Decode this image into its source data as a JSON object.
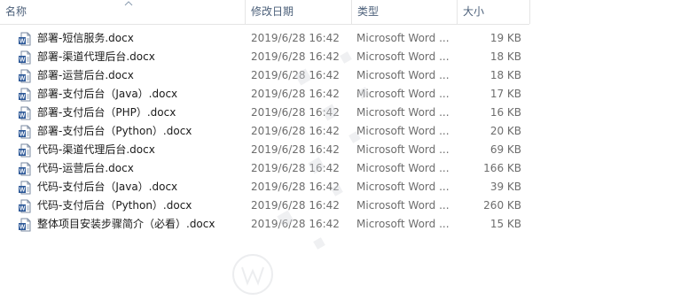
{
  "columns": {
    "name": "名称",
    "date": "修改日期",
    "type": "类型",
    "size": "大小"
  },
  "files": [
    {
      "name": "部署-短信服务.docx",
      "date": "2019/6/28 16:42",
      "type": "Microsoft Word ...",
      "size": "19 KB",
      "icon": "word-doc-icon"
    },
    {
      "name": "部署-渠道代理后台.docx",
      "date": "2019/6/28 16:42",
      "type": "Microsoft Word ...",
      "size": "18 KB",
      "icon": "word-doc-icon"
    },
    {
      "name": "部署-运营后台.docx",
      "date": "2019/6/28 16:42",
      "type": "Microsoft Word ...",
      "size": "18 KB",
      "icon": "word-doc-icon"
    },
    {
      "name": "部署-支付后台（Java）.docx",
      "date": "2019/6/28 16:42",
      "type": "Microsoft Word ...",
      "size": "17 KB",
      "icon": "word-doc-icon"
    },
    {
      "name": "部署-支付后台（PHP）.docx",
      "date": "2019/6/28 16:42",
      "type": "Microsoft Word ...",
      "size": "16 KB",
      "icon": "word-doc-icon"
    },
    {
      "name": "部署-支付后台（Python）.docx",
      "date": "2019/6/28 16:42",
      "type": "Microsoft Word ...",
      "size": "20 KB",
      "icon": "word-doc-icon"
    },
    {
      "name": "代码-渠道代理后台.docx",
      "date": "2019/6/28 16:42",
      "type": "Microsoft Word ...",
      "size": "69 KB",
      "icon": "word-doc-icon"
    },
    {
      "name": "代码-运营后台.docx",
      "date": "2019/6/28 16:42",
      "type": "Microsoft Word ...",
      "size": "166 KB",
      "icon": "word-doc-icon"
    },
    {
      "name": "代码-支付后台（Java）.docx",
      "date": "2019/6/28 16:42",
      "type": "Microsoft Word ...",
      "size": "39 KB",
      "icon": "word-doc-icon"
    },
    {
      "name": "代码-支付后台（Python）.docx",
      "date": "2019/6/28 16:42",
      "type": "Microsoft Word ...",
      "size": "260 KB",
      "icon": "word-doc-icon"
    },
    {
      "name": "整体项目安装步骤简介（必看）.docx",
      "date": "2019/6/28 16:42",
      "type": "Microsoft Word ...",
      "size": "15 KB",
      "icon": "word-doc-icon"
    }
  ],
  "colors": {
    "header_text": "#4c607a",
    "secondary_text": "#6d6d6d",
    "word_blue": "#2b5797"
  }
}
